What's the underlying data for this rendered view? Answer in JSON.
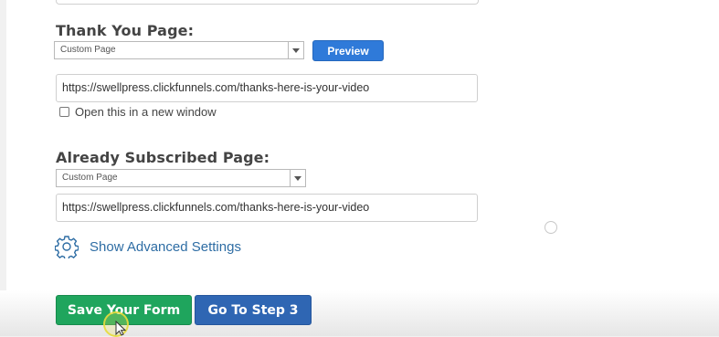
{
  "thank_you": {
    "label": "Thank You Page:",
    "select_value": "Custom Page",
    "preview_label": "Preview",
    "url_value": "https://swellpress.clickfunnels.com/thanks-here-is-your-video",
    "new_window_label": "Open this in a new window"
  },
  "already_subscribed": {
    "label": "Already Subscribed Page:",
    "select_value": "Custom Page",
    "url_value": "https://swellpress.clickfunnels.com/thanks-here-is-your-video"
  },
  "advanced": {
    "link_label": "Show Advanced Settings",
    "icon": "gear-icon"
  },
  "actions": {
    "save_label": "Save Your Form",
    "next_label": "Go To Step 3"
  },
  "colors": {
    "save_button": "#1fa55d",
    "next_button": "#2f66b3",
    "preview_button": "#2f7ad9",
    "link": "#2e6da4"
  }
}
